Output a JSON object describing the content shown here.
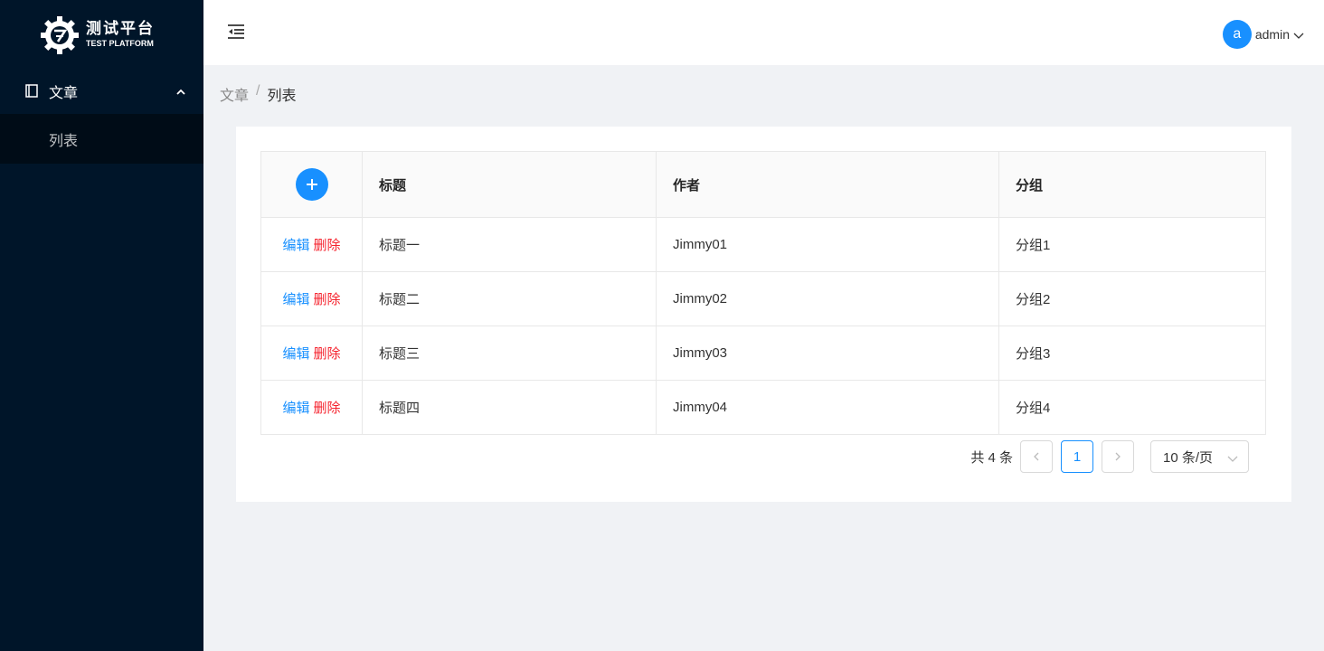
{
  "brand": {
    "name_cn": "测试平台",
    "name_en": "TEST PLATFORM"
  },
  "sidebar": {
    "group": {
      "label": "文章",
      "icon": "book-icon",
      "expanded": true
    },
    "items": [
      {
        "label": "列表",
        "active": true
      }
    ]
  },
  "header": {
    "user": {
      "avatar_letter": "a",
      "name": "admin"
    }
  },
  "breadcrumb": {
    "items": [
      "文章",
      "列表"
    ],
    "separator": "/"
  },
  "table": {
    "columns": [
      "标题",
      "作者",
      "分组"
    ],
    "actions": {
      "edit": "编辑",
      "delete": "删除"
    },
    "rows": [
      {
        "title": "标题一",
        "author": "Jimmy01",
        "group": "分组1"
      },
      {
        "title": "标题二",
        "author": "Jimmy02",
        "group": "分组2"
      },
      {
        "title": "标题三",
        "author": "Jimmy03",
        "group": "分组3"
      },
      {
        "title": "标题四",
        "author": "Jimmy04",
        "group": "分组4"
      }
    ]
  },
  "pagination": {
    "total_text": "共 4 条",
    "current_page": "1",
    "page_size": "10 条/页"
  },
  "colors": {
    "sidebar": "#001529",
    "primary": "#1890ff",
    "danger": "#f5222d"
  }
}
